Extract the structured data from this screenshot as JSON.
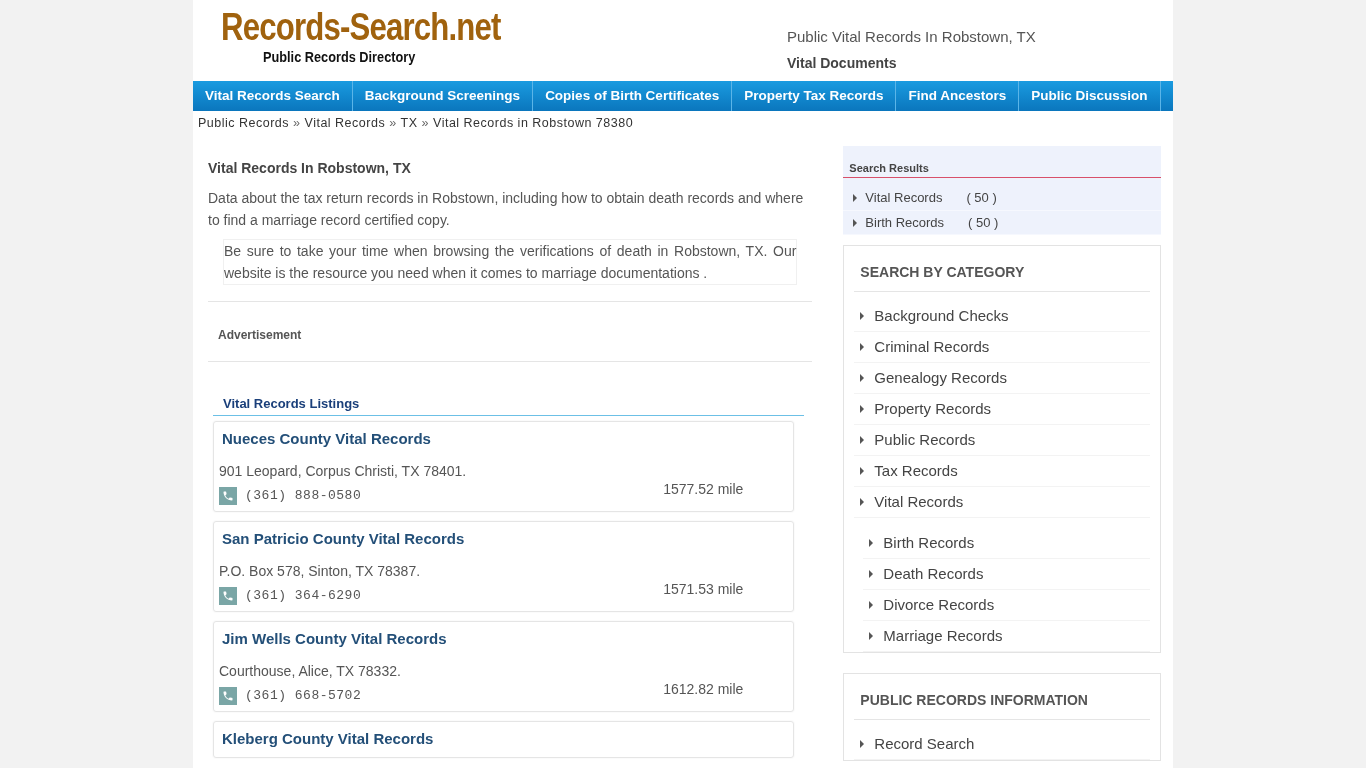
{
  "logo": {
    "title": "Records-Search.net",
    "subtitle": "Public Records Directory"
  },
  "header": {
    "title": "Public Vital Records In Robstown, TX",
    "subtitle": "Vital Documents"
  },
  "nav": [
    "Vital Records Search",
    "Background Screenings",
    "Copies of Birth Certificates",
    "Property Tax Records",
    "Find Ancestors",
    "Public Discussion"
  ],
  "breadcrumb": [
    {
      "kind": "link",
      "text": "Public Records"
    },
    {
      "kind": "separator",
      "text": "»"
    },
    {
      "kind": "link",
      "text": "Vital Records"
    },
    {
      "kind": "separator",
      "text": "»"
    },
    {
      "kind": "link",
      "text": "TX"
    },
    {
      "kind": "separator",
      "text": "»"
    },
    {
      "kind": "link",
      "text": "Vital Records in Robstown 78380"
    }
  ],
  "article": {
    "heading": "Vital Records In Robstown, TX",
    "intro": "Data about the tax return records in Robstown, including how to obtain death records and where to find a marriage record certified copy.",
    "note": "Be sure to take your time when browsing the verifications of death in Robstown, TX. Our website is the resource you need when it comes to marriage documentations .",
    "ad_label": "Advertisement"
  },
  "listings": {
    "title": "Vital Records Listings",
    "items": [
      {
        "name": "Nueces County Vital Records",
        "address": "901 Leopard, Corpus Christi, TX 78401.",
        "phone": "(361) 888-0580",
        "distance": "1577.52 mile"
      },
      {
        "name": "San Patricio County Vital Records",
        "address": "P.O. Box 578, Sinton, TX 78387.",
        "phone": "(361) 364-6290",
        "distance": "1571.53 mile"
      },
      {
        "name": "Jim Wells County Vital Records",
        "address": "Courthouse, Alice, TX 78332.",
        "phone": "(361) 668-5702",
        "distance": "1612.82 mile"
      },
      {
        "name": "Kleberg County Vital Records"
      }
    ]
  },
  "search_results": {
    "title": "Search Results",
    "items": [
      {
        "label": "Vital Records",
        "count": "( 50 )"
      },
      {
        "label": "Birth Records",
        "count": "( 50 )"
      }
    ]
  },
  "categories": {
    "title": "SEARCH BY CATEGORY",
    "items": [
      {
        "label": "Background Checks"
      },
      {
        "label": "Criminal Records"
      },
      {
        "label": "Genealogy Records"
      },
      {
        "label": "Property Records"
      },
      {
        "label": "Public Records"
      },
      {
        "label": "Tax Records"
      },
      {
        "label": "Vital Records",
        "children": [
          {
            "label": "Birth Records"
          },
          {
            "label": "Death Records"
          },
          {
            "label": "Divorce Records"
          },
          {
            "label": "Marriage Records"
          }
        ]
      }
    ]
  },
  "info": {
    "title": "PUBLIC RECORDS INFORMATION",
    "items": [
      {
        "label": "Record Search"
      }
    ]
  }
}
